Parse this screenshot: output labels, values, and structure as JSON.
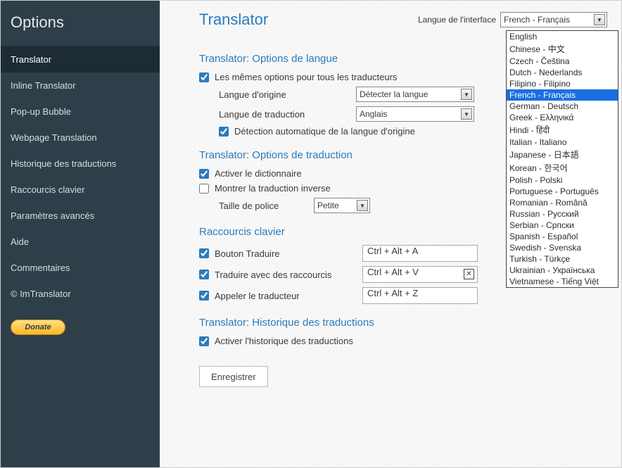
{
  "sidebar": {
    "title": "Options",
    "items": [
      {
        "label": "Translator",
        "active": true
      },
      {
        "label": "Inline Translator"
      },
      {
        "label": "Pop-up Bubble"
      },
      {
        "label": "Webpage Translation"
      },
      {
        "label": "Historique des traductions"
      },
      {
        "label": "Raccourcis clavier"
      },
      {
        "label": "Paramètres avancés"
      },
      {
        "label": "Aide"
      },
      {
        "label": "Commentaires"
      },
      {
        "label": "© ImTranslator"
      }
    ],
    "donate_label": "Donate"
  },
  "header": {
    "title": "Translator",
    "lang_label": "Langue de l'interface",
    "lang_selected": "French - Français",
    "lang_options": [
      "English",
      "Chinese - 中文",
      "Czech - Čeština",
      "Dutch - Nederlands",
      "Filipino - Filipino",
      "French - Français",
      "German - Deutsch",
      "Greek - Ελληνικά",
      "Hindi - हिंदी",
      "Italian - Italiano",
      "Japanese - 日本語",
      "Korean - 한국어",
      "Polish - Polski",
      "Portuguese - Português",
      "Romanian - Română",
      "Russian - Русский",
      "Serbian - Српски",
      "Spanish - Español",
      "Swedish - Svenska",
      "Turkish - Türkçe",
      "Ukrainian - Українська",
      "Vietnamese - Tiếng Việt"
    ]
  },
  "langopts": {
    "title": "Translator: Options de langue",
    "same_label": "Les mêmes options pour tous les traducteurs",
    "src_label": "Langue d'origine",
    "src_value": "Détecter la langue",
    "tgt_label": "Langue de traduction",
    "tgt_value": "Anglais",
    "autodetect_label": "Détection automatique de la langue d'origine"
  },
  "transopts": {
    "title": "Translator: Options de traduction",
    "dict_label": "Activer le dictionnaire",
    "reverse_label": "Montrer la traduction inverse",
    "font_label": "Taille de police",
    "font_value": "Petite"
  },
  "shortcuts": {
    "title": "Raccourcis clavier",
    "items": [
      {
        "label": "Bouton Traduire",
        "value": "Ctrl + Alt + A",
        "clearable": false
      },
      {
        "label": "Traduire avec des raccourcis",
        "value": "Ctrl + Alt + V",
        "clearable": true
      },
      {
        "label": "Appeler le traducteur",
        "value": "Ctrl + Alt + Z",
        "clearable": false
      }
    ]
  },
  "history": {
    "title": "Translator: Historique des traductions",
    "enable_label": "Activer l'historique des traductions"
  },
  "save_label": "Enregistrer"
}
